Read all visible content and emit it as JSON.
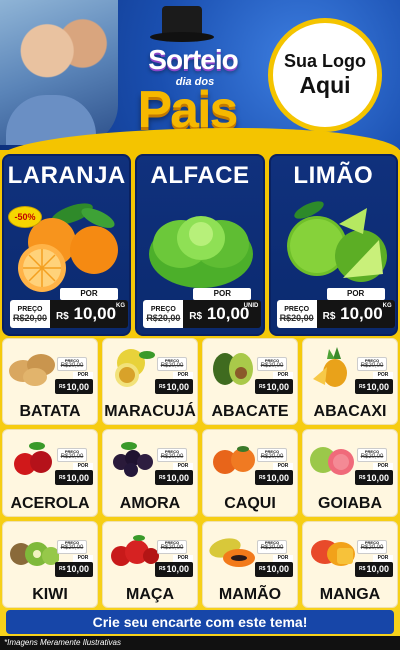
{
  "header": {
    "title_top": "Sorteio",
    "title_middle": "dia dos",
    "title_bottom": "Pais",
    "logo_line1": "Sua Logo",
    "logo_line2": "Aqui"
  },
  "featured": [
    {
      "name": "LARANJA",
      "badge": "-50%",
      "old_label": "PREÇO",
      "old_price": "R$20,00",
      "por": "POR",
      "currency": "R$",
      "price": "10,00",
      "unit": "KG",
      "icon": "orange-icon"
    },
    {
      "name": "ALFACE",
      "old_label": "PREÇO",
      "old_price": "R$20,00",
      "por": "POR",
      "currency": "R$",
      "price": "10,00",
      "unit": "UNID",
      "icon": "lettuce-icon"
    },
    {
      "name": "LIMÃO",
      "old_label": "PREÇO",
      "old_price": "R$20,00",
      "por": "POR",
      "currency": "R$",
      "price": "10,00",
      "unit": "KG",
      "icon": "lime-icon"
    }
  ],
  "products": [
    {
      "name": "BATATA",
      "old_label": "PREÇO",
      "old_price": "R$20,00",
      "por": "POR",
      "currency": "R$",
      "price": "10,00",
      "icon": "potato-icon"
    },
    {
      "name": "MARACUJÁ",
      "old_label": "PREÇO",
      "old_price": "R$20,00",
      "por": "POR",
      "currency": "R$",
      "price": "10,00",
      "icon": "passion-fruit-icon"
    },
    {
      "name": "ABACATE",
      "old_label": "PREÇO",
      "old_price": "R$20,00",
      "por": "POR",
      "currency": "R$",
      "price": "10,00",
      "icon": "avocado-icon"
    },
    {
      "name": "ABACAXI",
      "old_label": "PREÇO",
      "old_price": "R$20,00",
      "por": "POR",
      "currency": "R$",
      "price": "10,00",
      "icon": "pineapple-icon"
    },
    {
      "name": "ACEROLA",
      "old_label": "PREÇO",
      "old_price": "R$20,00",
      "por": "POR",
      "currency": "R$",
      "price": "10,00",
      "icon": "acerola-icon"
    },
    {
      "name": "AMORA",
      "old_label": "PREÇO",
      "old_price": "R$20,00",
      "por": "POR",
      "currency": "R$",
      "price": "10,00",
      "icon": "blackberry-icon"
    },
    {
      "name": "CAQUI",
      "old_label": "PREÇO",
      "old_price": "R$20,00",
      "por": "POR",
      "currency": "R$",
      "price": "10,00",
      "icon": "persimmon-icon"
    },
    {
      "name": "GOIABA",
      "old_label": "PREÇO",
      "old_price": "R$20,00",
      "por": "POR",
      "currency": "R$",
      "price": "10,00",
      "icon": "guava-icon"
    },
    {
      "name": "KIWI",
      "old_label": "PREÇO",
      "old_price": "R$20,00",
      "por": "POR",
      "currency": "R$",
      "price": "10,00",
      "icon": "kiwi-icon"
    },
    {
      "name": "MAÇA",
      "old_label": "PREÇO",
      "old_price": "R$20,00",
      "por": "POR",
      "currency": "R$",
      "price": "10,00",
      "icon": "apple-icon"
    },
    {
      "name": "MAMÃO",
      "old_label": "PREÇO",
      "old_price": "R$20,00",
      "por": "POR",
      "currency": "R$",
      "price": "10,00",
      "icon": "papaya-icon"
    },
    {
      "name": "MANGA",
      "old_label": "PREÇO",
      "old_price": "R$20,00",
      "por": "POR",
      "currency": "R$",
      "price": "10,00",
      "icon": "mango-icon"
    }
  ],
  "footer": {
    "cta": "Crie seu encarte com este tema!",
    "disclaimer": "*Imagens Meramente Ilustrativas"
  },
  "colors": {
    "header_blue": "#1a4fb0",
    "accent_yellow": "#f4c400",
    "card_navy": "#10317d",
    "price_black": "#141414"
  }
}
